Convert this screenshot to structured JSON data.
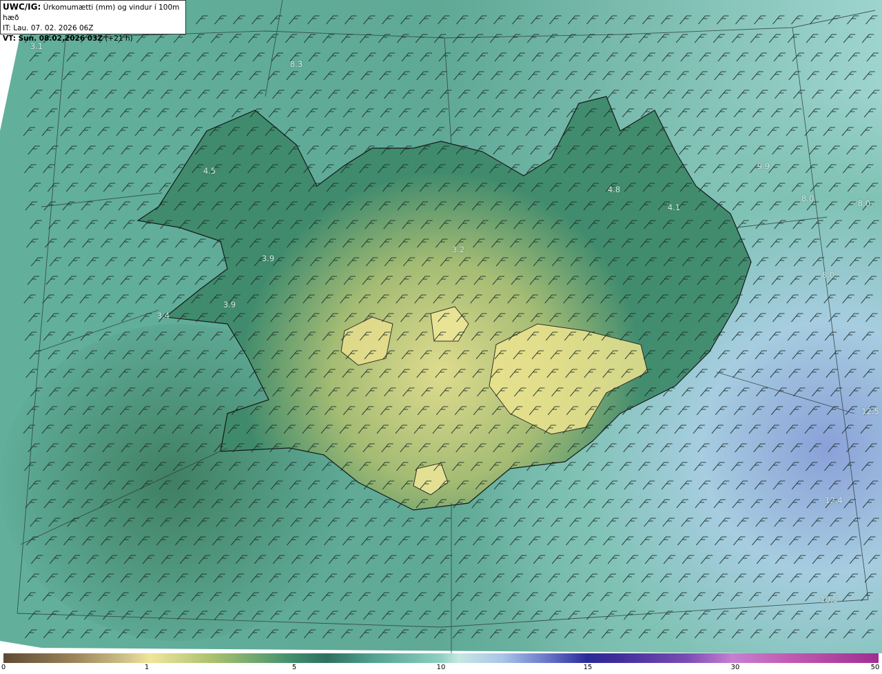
{
  "header": {
    "product": "UWC/IG:",
    "description": "Úrkomumætti (mm) og vindur í 100m hæð",
    "issue_time": "IT: Lau. 07. 02. 2026 06Z",
    "valid_label": "VT: Sun. 08.02.2026 03Z",
    "valid_offset": "(+21 h)"
  },
  "map": {
    "wind_barb_color": "#1a2a28",
    "coastline_color": "#111111",
    "gridline_color": "#2a3a38",
    "value_labels": [
      "3.1",
      "8.3",
      "4.5",
      "4.8",
      "4.1",
      "9.9",
      "8.0",
      "8.0",
      "3.9",
      "3.2",
      "3.9",
      "3.4",
      "8.0",
      "12.5",
      "12.4",
      "10.5"
    ]
  },
  "colorbar": {
    "ticks": [
      "0",
      "1",
      "5",
      "10",
      "15",
      "30",
      "50"
    ],
    "tick_values": [
      0,
      1,
      5,
      10,
      15,
      30,
      50
    ]
  }
}
